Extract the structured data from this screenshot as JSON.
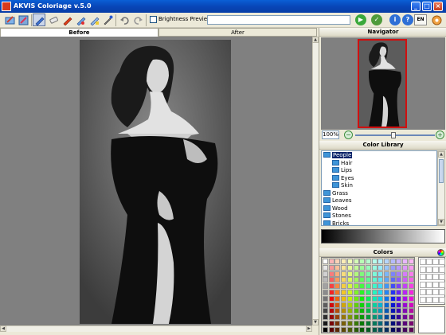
{
  "window": {
    "title": "AKVIS Coloriage v.5.0",
    "minimize_label": "_",
    "maximize_label": "□",
    "close_label": "×"
  },
  "toolbar": {
    "tools": [
      {
        "name": "open-icon"
      },
      {
        "name": "save-icon"
      },
      {
        "name": "pencil-icon",
        "pressed": true
      },
      {
        "name": "eraser-icon"
      },
      {
        "name": "color-pencil-icon"
      },
      {
        "name": "keep-color-pencil-icon"
      },
      {
        "name": "magic-tube-icon"
      },
      {
        "name": "eyedropper-icon"
      }
    ],
    "undo_icon": "undo-icon",
    "redo_icon": "redo-icon",
    "brightness_preview_label": "Brightness Preview",
    "brightness_preview_checked": false,
    "path_value": "",
    "run_label": "▶",
    "apply_label": "✓",
    "info_label": "i",
    "help_label": "?",
    "language": "EN",
    "colors": {
      "run": "#3aa83a",
      "apply": "#4f9b3b",
      "info": "#2e6fd6",
      "help": "#2e6fd6"
    }
  },
  "tabs": [
    {
      "label": "Before",
      "active": true
    },
    {
      "label": "After",
      "active": false
    }
  ],
  "navigator": {
    "title": "Navigator",
    "zoom": "100%",
    "zoom_slider_fraction": 0.48
  },
  "color_library": {
    "title": "Color Library",
    "items": [
      {
        "label": "People",
        "selected": true,
        "indent": 0
      },
      {
        "label": "Hair",
        "selected": false,
        "indent": 1
      },
      {
        "label": "Lips",
        "selected": false,
        "indent": 1
      },
      {
        "label": "Eyes",
        "selected": false,
        "indent": 1
      },
      {
        "label": "Skin",
        "selected": false,
        "indent": 1
      },
      {
        "label": "Grass",
        "selected": false,
        "indent": 0
      },
      {
        "label": "Leaves",
        "selected": false,
        "indent": 0
      },
      {
        "label": "Wood",
        "selected": false,
        "indent": 0
      },
      {
        "label": "Stones",
        "selected": false,
        "indent": 0
      },
      {
        "label": "Bricks",
        "selected": false,
        "indent": 0
      }
    ]
  },
  "colors_panel": {
    "title": "Colors",
    "wheel_icon": "color-wheel-icon"
  },
  "accent_colors": {
    "titlebar": "#0846b8",
    "selection": "#0a246a",
    "navigator_frame": "#d01010"
  }
}
